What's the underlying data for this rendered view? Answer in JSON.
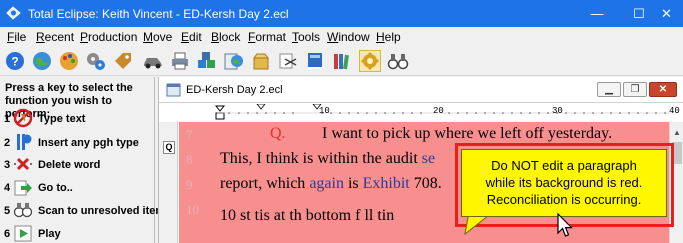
{
  "window": {
    "title": "Total Eclipse: Keith Vincent - ED-Kersh Day 2.ecl",
    "minimize_glyph": "—",
    "maximize_glyph": "☐",
    "close_glyph": "✕"
  },
  "menu": {
    "items": [
      {
        "label": "File"
      },
      {
        "label": "Recent"
      },
      {
        "label": "Production"
      },
      {
        "label": "Move"
      },
      {
        "label": "Edit"
      },
      {
        "label": "Block"
      },
      {
        "label": "Format"
      },
      {
        "label": "Tools"
      },
      {
        "label": "Window"
      },
      {
        "label": "Help"
      }
    ]
  },
  "toolbar": {
    "icons": [
      "help-icon",
      "globe-icon",
      "palette-icon",
      "gears-icon",
      "tag-icon",
      "car-icon",
      "printer-icon",
      "blocks-icon",
      "globe-doc-icon",
      "box-icon",
      "scissors-icon",
      "book-icon",
      "library-icon",
      "settings-gear-icon",
      "binoculars-icon"
    ]
  },
  "left_panel": {
    "heading": "Press a key to select the function you wish to perform:",
    "items": [
      {
        "key": "1",
        "label": "Type text",
        "icon": "no-symbol-icon"
      },
      {
        "key": "2",
        "label": "Insert any pgh type",
        "icon": "paragraph-icon"
      },
      {
        "key": "3",
        "label": "Delete word",
        "icon": "delete-x-icon"
      },
      {
        "key": "4",
        "label": "Go to..",
        "icon": "arrow-right-icon"
      },
      {
        "key": "5",
        "label": "Scan to unresolved item",
        "icon": "scan-icon"
      },
      {
        "key": "6",
        "label": "Play",
        "icon": "play-icon"
      }
    ]
  },
  "document": {
    "title": "ED-Kersh Day 2.ecl",
    "gutter_marker": "Q",
    "ruler_labels": [
      "10",
      "20",
      "30",
      "40"
    ],
    "background_color": "#f78f8f",
    "lines": [
      {
        "num": "7",
        "label": "Q.",
        "text": "I want to pick up where we left off yesterday."
      },
      {
        "num": "8",
        "text_a": "This, I think is within the audit ",
        "text_b": "se"
      },
      {
        "num": "9",
        "text_a": "report, which ",
        "text_b": "again",
        "text_c": " is ",
        "text_d": "Exhibit",
        "text_e": " 708."
      },
      {
        "num": "10",
        "text_a": "10 st   tis  at  th  bottom  f    ll  tin   "
      }
    ]
  },
  "tooltip": {
    "lines": [
      "Do NOT edit a paragraph",
      "while its background is red.",
      "Reconciliation is occurring."
    ],
    "background_color": "#fff700",
    "frame_color": "#e8201c"
  }
}
